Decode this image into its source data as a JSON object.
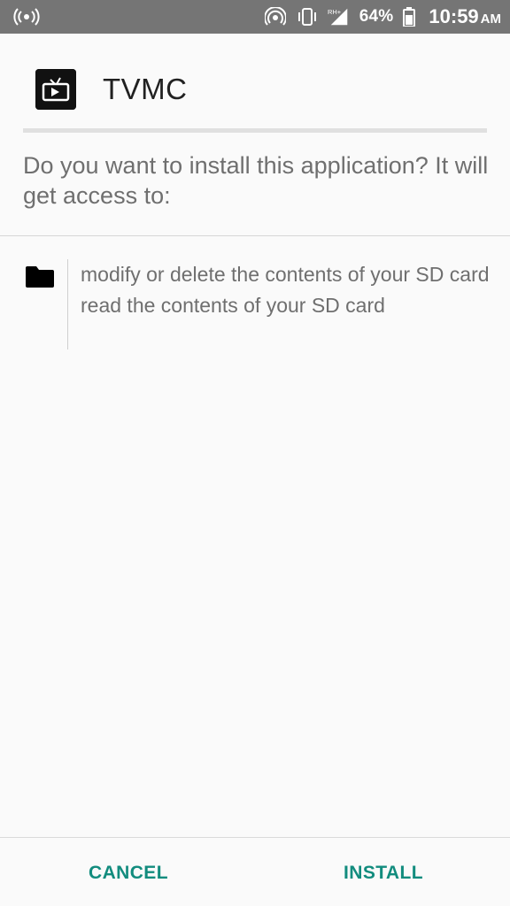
{
  "status_bar": {
    "battery_percent": "64%",
    "time": "10:59",
    "ampm": "AM",
    "network_label": "RH+",
    "icons": [
      "hotspot-icon",
      "wireless-icon",
      "vibrate-icon",
      "signal-icon",
      "battery-icon"
    ]
  },
  "app": {
    "name": "TVMC",
    "icon": "tv-icon"
  },
  "prompt": {
    "question": "Do you want to install this application? It will get access to:"
  },
  "permissions": {
    "group_icon": "folder-icon",
    "items": [
      "modify or delete the contents of your SD card",
      "read the contents of your SD card"
    ]
  },
  "actions": {
    "cancel_label": "CANCEL",
    "install_label": "INSTALL"
  },
  "colors": {
    "status_bar": "#757575",
    "background": "#fafafa",
    "accent": "#128c7e",
    "title_text": "#212121",
    "body_text": "#6f6f6f"
  }
}
